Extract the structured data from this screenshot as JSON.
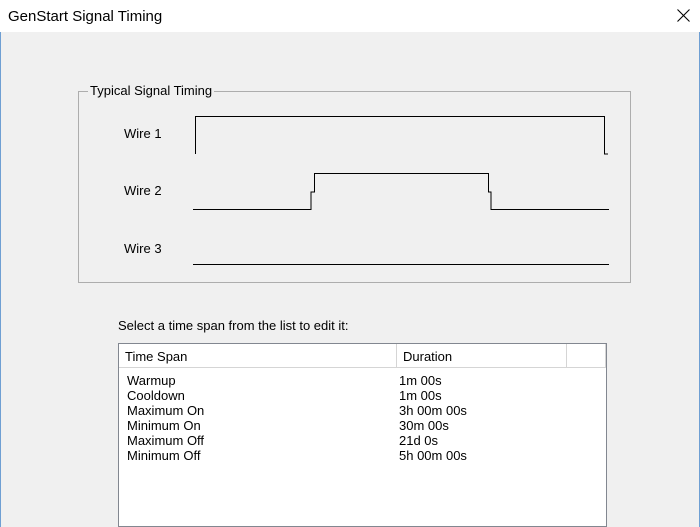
{
  "window": {
    "title": "GenStart Signal Timing"
  },
  "groupbox": {
    "title": "Typical Signal Timing",
    "wires": [
      {
        "label": "Wire 1"
      },
      {
        "label": "Wire 2"
      },
      {
        "label": "Wire 3"
      }
    ]
  },
  "instruction": "Select a time span from the list to edit it:",
  "list": {
    "columns": [
      "Time Span",
      "Duration"
    ],
    "rows": [
      {
        "span": "Warmup",
        "duration": "1m 00s"
      },
      {
        "span": "Cooldown",
        "duration": "1m 00s"
      },
      {
        "span": "Maximum On",
        "duration": "3h 00m 00s"
      },
      {
        "span": "Minimum On",
        "duration": "30m 00s"
      },
      {
        "span": "Maximum Off",
        "duration": "21d 0s"
      },
      {
        "span": "Minimum Off",
        "duration": "5h 00m 00s"
      }
    ]
  },
  "colors": {
    "background": "#f0f0f0",
    "window_frame": "#6f9fd3",
    "list_border": "#828790",
    "signal_line": "#000000"
  },
  "icons": {
    "close": "close-icon"
  }
}
